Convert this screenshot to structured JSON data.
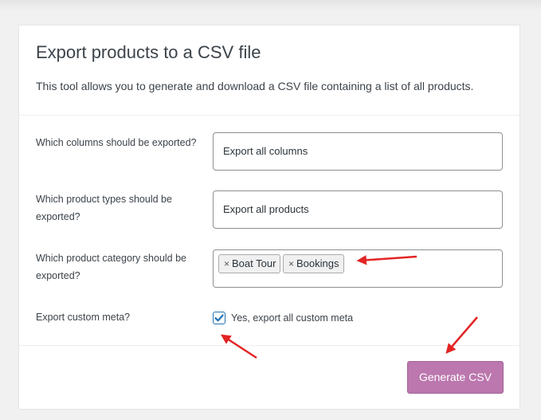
{
  "panel": {
    "title": "Export products to a CSV file",
    "description": "This tool allows you to generate and download a CSV file containing a list of all products."
  },
  "fields": {
    "columns_label": "Which columns should be exported?",
    "columns_value": "Export all columns",
    "types_label": "Which product types should be exported?",
    "types_value": "Export all products",
    "category_label": "Which product category should be exported?",
    "category_tags": [
      {
        "remove": "×",
        "label": "Boat Tour"
      },
      {
        "remove": "×",
        "label": "Bookings"
      }
    ],
    "meta_label": "Export custom meta?",
    "meta_checkbox_label": "Yes, export all custom meta",
    "meta_checked": true
  },
  "actions": {
    "generate_label": "Generate CSV"
  },
  "colors": {
    "accent": "#bb77ae",
    "checkbox": "#2271b1",
    "annotation_arrow": "#e32424"
  },
  "icons": {
    "checkbox": "checkmark-icon",
    "annotation": "red-arrow-icon"
  }
}
